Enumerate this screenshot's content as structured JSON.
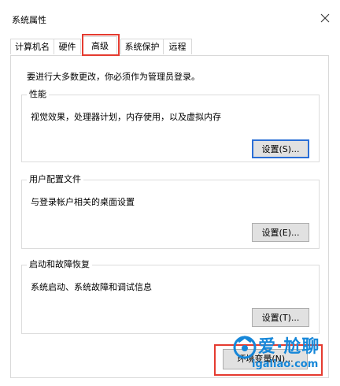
{
  "window": {
    "title": "系统属性"
  },
  "tabs": [
    {
      "label": "计算机名"
    },
    {
      "label": "硬件"
    },
    {
      "label": "高级"
    },
    {
      "label": "系统保护"
    },
    {
      "label": "远程"
    }
  ],
  "main": {
    "intro": "要进行大多数更改，你必须作为管理员登录。",
    "groups": [
      {
        "title": "性能",
        "description": "视觉效果，处理器计划，内存使用，以及虚拟内存",
        "button": "设置(S)..."
      },
      {
        "title": "用户配置文件",
        "description": "与登录帐户相关的桌面设置",
        "button": "设置(E)..."
      },
      {
        "title": "启动和故障恢复",
        "description": "系统启动、系统故障和调试信息",
        "button": "设置(T)..."
      }
    ],
    "env_button": "环境变量(N)..."
  },
  "watermark": {
    "main": "爱·尬聊",
    "url": "igaliao.com"
  },
  "colors": {
    "highlight": "#e53b30",
    "focus": "#2b6fd6",
    "watermark": "#1687d9"
  },
  "icons": {
    "close": "close-icon",
    "watermark_logo": "watermark-logo-icon"
  }
}
